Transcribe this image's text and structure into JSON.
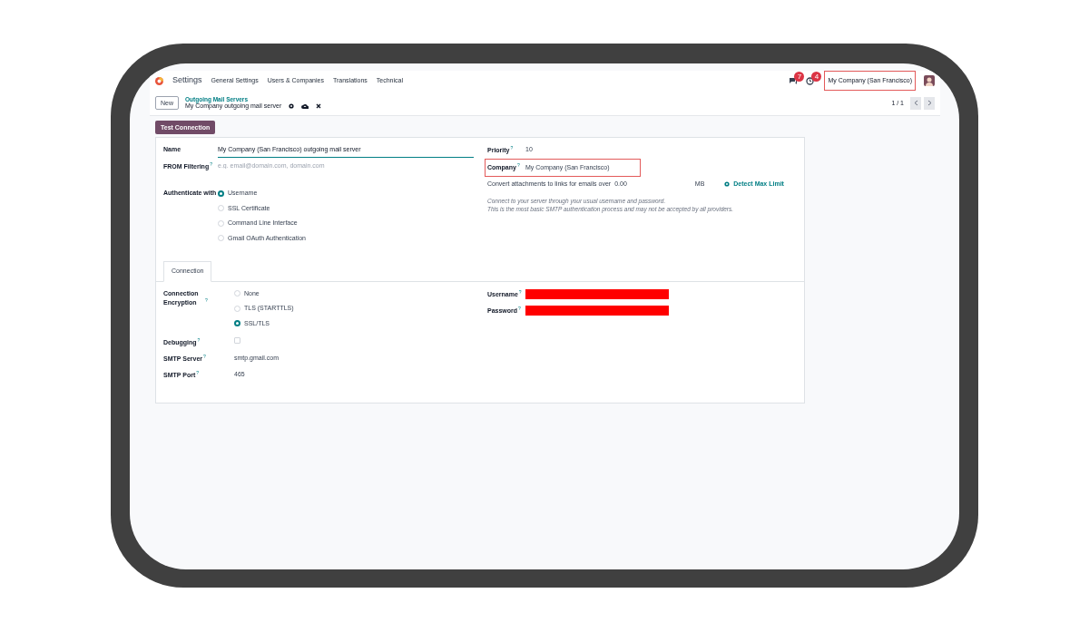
{
  "navbar": {
    "app_name": "Settings",
    "menu": [
      "General Settings",
      "Users & Companies",
      "Translations",
      "Technical"
    ],
    "chat_count": "7",
    "activity_count": "4",
    "company": "My Company (San Francisco)",
    "company_highlighted": true
  },
  "control_panel": {
    "new_button": "New",
    "breadcrumb_parent": "Outgoing Mail Servers",
    "record_name": "My Company outgoing mail server",
    "pager": "1 / 1"
  },
  "action_button": "Test Connection",
  "form": {
    "name": {
      "label": "Name",
      "value": "My Company (San Francisco) outgoing mail server"
    },
    "from_filter": {
      "label": "FROM Filtering",
      "help": "?",
      "placeholder": "e.g. email@domain.com, domain.com"
    },
    "authenticate": {
      "label": "Authenticate with",
      "options": [
        {
          "label": "Username",
          "selected": true
        },
        {
          "label": "SSL Certificate",
          "selected": false
        },
        {
          "label": "Command Line Interface",
          "selected": false
        },
        {
          "label": "Gmail OAuth Authentication",
          "selected": false
        }
      ]
    },
    "priority": {
      "label": "Priority",
      "help": "?",
      "value": "10"
    },
    "company": {
      "label": "Company",
      "help": "?",
      "value": "My Company (San Francisco)",
      "highlighted": true
    },
    "attachments": {
      "text": "Convert attachments to links for emails over",
      "value": "0.00",
      "unit": "MB",
      "button": "Detect Max Limit"
    },
    "description": [
      "Connect to your server through your usual username and password.",
      "This is the most basic SMTP authentication process and may not be accepted by all providers."
    ]
  },
  "tabs": [
    {
      "label": "Connection",
      "selected": true
    }
  ],
  "connection": {
    "encryption": {
      "label": "Connection Encryption",
      "help": "?",
      "options": [
        {
          "label": "None",
          "selected": false
        },
        {
          "label": "TLS (STARTTLS)",
          "selected": false
        },
        {
          "label": "SSL/TLS",
          "selected": true
        }
      ]
    },
    "debugging": {
      "label": "Debugging",
      "help": "?",
      "checked": false
    },
    "smtp_server": {
      "label": "SMTP Server",
      "help": "?",
      "value": "smtp.gmail.com"
    },
    "smtp_port": {
      "label": "SMTP Port",
      "help": "?",
      "value": "465"
    },
    "username": {
      "label": "Username",
      "help": "?",
      "redacted": true
    },
    "password": {
      "label": "Password",
      "help": "?",
      "redacted": true
    }
  }
}
